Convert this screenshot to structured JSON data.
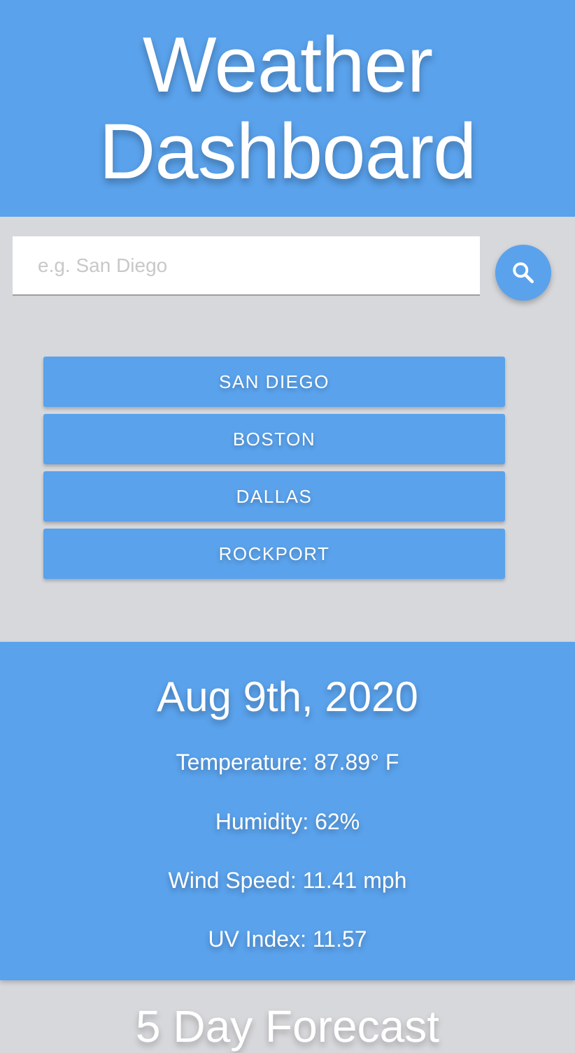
{
  "header": {
    "title": "Weather Dashboard"
  },
  "search": {
    "placeholder": "e.g. San Diego",
    "value": "",
    "button_icon": "search-icon"
  },
  "cities": [
    {
      "label": "SAN DIEGO"
    },
    {
      "label": "BOSTON"
    },
    {
      "label": "DALLAS"
    },
    {
      "label": "ROCKPORT"
    }
  ],
  "current": {
    "date": "Aug 9th, 2020",
    "temperature": "Temperature: 87.89° F",
    "humidity": "Humidity: 62%",
    "wind_speed": "Wind Speed: 11.41 mph",
    "uv_index": "UV Index: 11.57"
  },
  "forecast": {
    "title": "5 Day Forecast"
  },
  "colors": {
    "accent": "#5aa2ec",
    "background": "#d7d8db",
    "text_light": "#ffffff"
  }
}
